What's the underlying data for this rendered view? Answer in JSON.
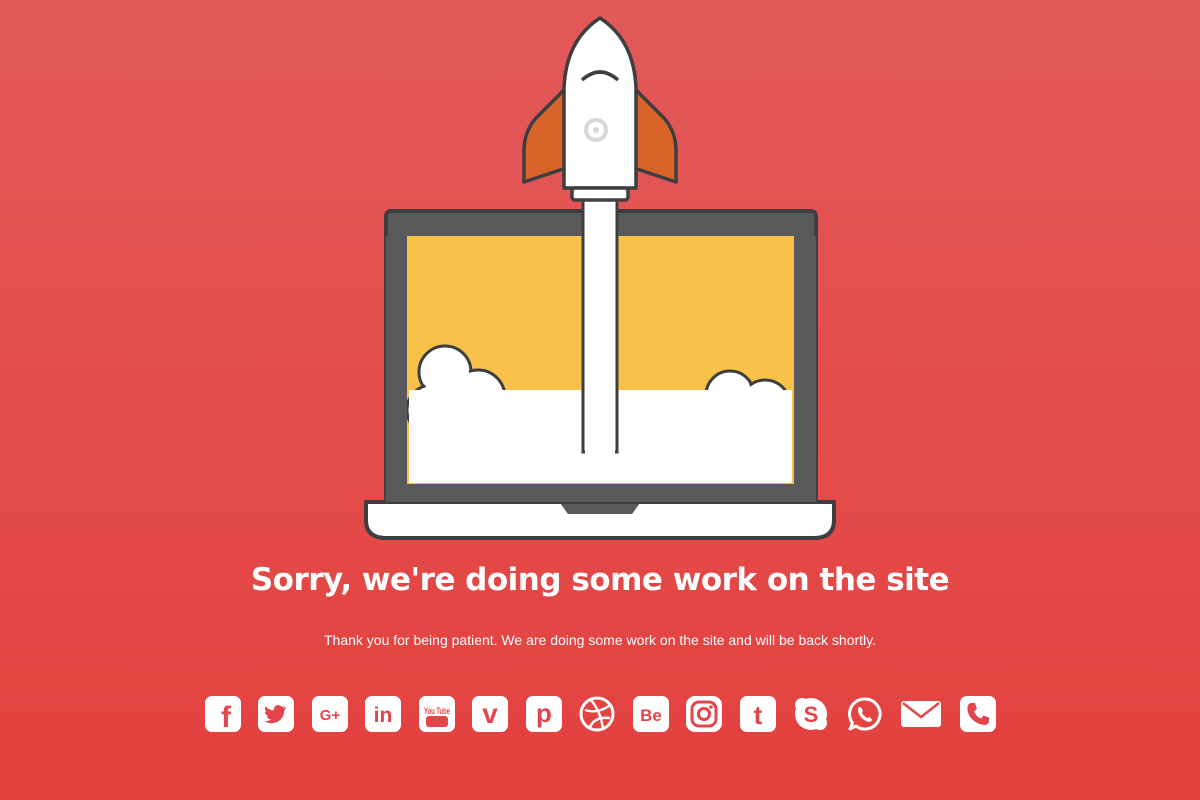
{
  "page": {
    "headline": "Sorry, we're doing some work on the site",
    "message": "Thank you for being patient. We are doing some work on the site and will be back shortly."
  },
  "colors": {
    "background_top": "#e35a5a",
    "background_bottom": "#e3403e",
    "screen_yellow": "#f8c14a",
    "laptop_frame": "#58595b",
    "rocket_fin": "#d8642a",
    "text": "#ffffff"
  },
  "social": [
    {
      "name": "facebook-icon",
      "text": "f"
    },
    {
      "name": "twitter-icon",
      "text": ""
    },
    {
      "name": "google-plus-icon",
      "text": "G+"
    },
    {
      "name": "linkedin-icon",
      "text": "in"
    },
    {
      "name": "youtube-icon",
      "text": "You Tube"
    },
    {
      "name": "vimeo-icon",
      "text": "v"
    },
    {
      "name": "pinterest-icon",
      "text": "p"
    },
    {
      "name": "dribbble-icon",
      "text": ""
    },
    {
      "name": "behance-icon",
      "text": "Be"
    },
    {
      "name": "instagram-icon",
      "text": ""
    },
    {
      "name": "tumblr-icon",
      "text": "t"
    },
    {
      "name": "skype-icon",
      "text": "S"
    },
    {
      "name": "whatsapp-icon",
      "text": ""
    },
    {
      "name": "email-icon",
      "text": ""
    },
    {
      "name": "phone-icon",
      "text": ""
    }
  ]
}
